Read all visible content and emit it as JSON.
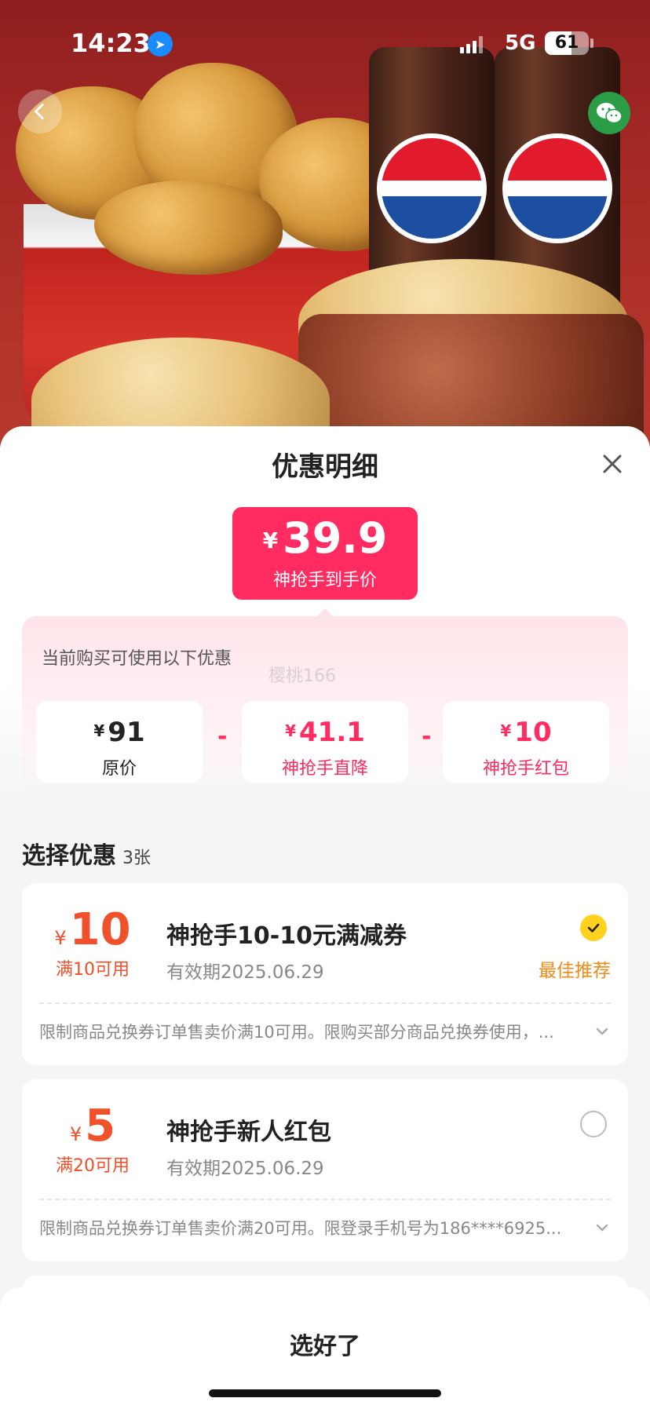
{
  "status_bar": {
    "time": "14:23",
    "network": "5G",
    "battery": "61",
    "battery_level": 0.61
  },
  "header_buttons": {
    "back_icon": "chevron-left-icon",
    "share_icon": "wechat-icon"
  },
  "hero": {
    "drink_brand": "百事可乐"
  },
  "sheet": {
    "title": "优惠明细",
    "close_icon": "close-icon",
    "final_price": {
      "currency": "¥",
      "amount": "39.9",
      "label": "神抢手到手价"
    },
    "breakdown": {
      "hint": "当前购买可使用以下优惠",
      "watermark": "樱桃166",
      "operator": "-",
      "items": [
        {
          "currency": "¥",
          "value": "91",
          "label": "原价"
        },
        {
          "currency": "¥",
          "value": "41.1",
          "label": "神抢手直降"
        },
        {
          "currency": "¥",
          "value": "10",
          "label": "神抢手红包"
        }
      ]
    },
    "select": {
      "title": "选择优惠",
      "count": "3张"
    },
    "coupons": [
      {
        "currency": "¥",
        "amount": "10",
        "condition": "满10可用",
        "name": "神抢手10-10元满减券",
        "validity": "有效期2025.06.29",
        "selected": true,
        "tag": "最佳推荐",
        "desc": "限制商品兑换券订单售卖价满10可用。限购买部分商品兑换券使用，..."
      },
      {
        "currency": "¥",
        "amount": "5",
        "condition": "满20可用",
        "name": "神抢手新人红包",
        "validity": "有效期2025.06.29",
        "selected": false,
        "tag": "",
        "desc": "限制商品兑换券订单售卖价满20可用。限登录手机号为186****6925..."
      }
    ],
    "confirm_label": "选好了"
  },
  "colors": {
    "accent": "#ff2b61",
    "coupon_orange": "#f0502a",
    "best_tag": "#f08a18",
    "check_yellow": "#ffd21f"
  }
}
